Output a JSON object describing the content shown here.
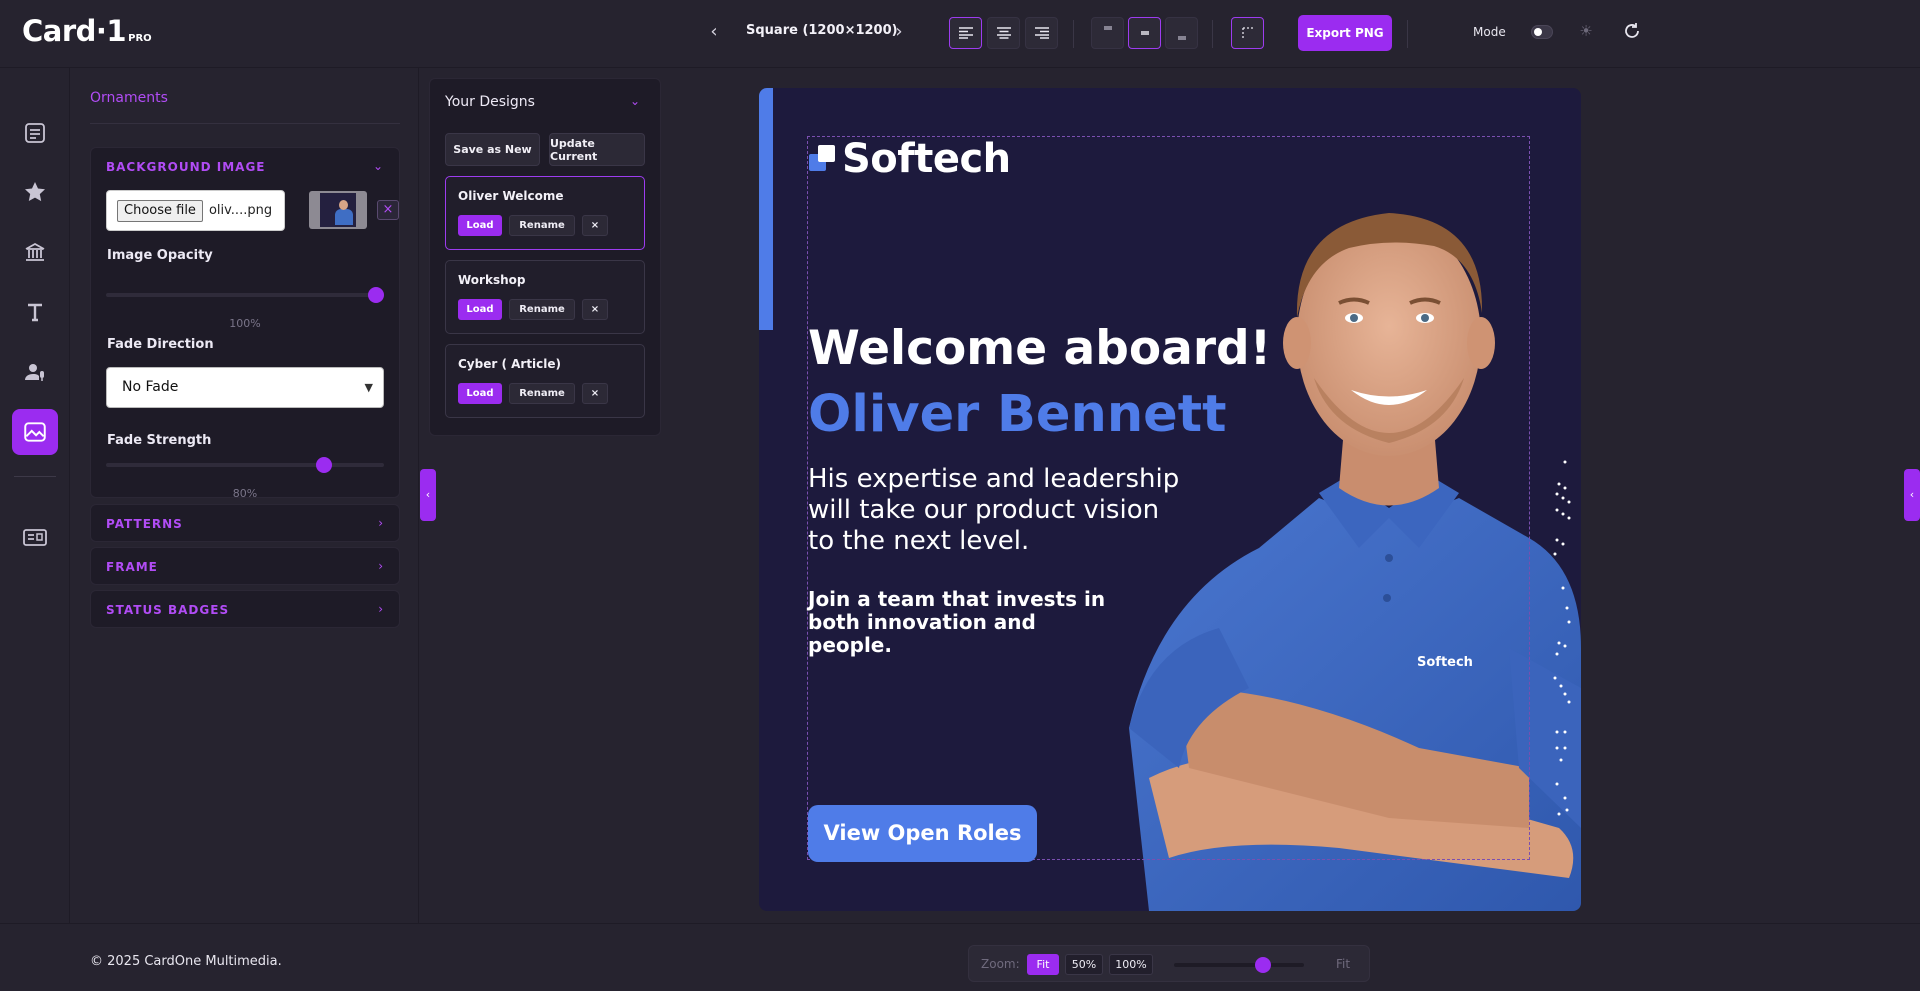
{
  "app": {
    "logo_main": "Card·1",
    "logo_sub": "PRO"
  },
  "toolbar": {
    "prev_label": "‹",
    "next_label": "›",
    "size_label": "Square (1200×1200)",
    "text_align_active": "left",
    "vertical_align_active": "middle",
    "export_label": "Export PNG",
    "mode_label": "Mode",
    "mode_dark": true
  },
  "rail": {
    "items": [
      "list-icon",
      "star-icon",
      "landmark-icon",
      "text-icon",
      "user-mic-icon",
      "image-icon",
      "id-card-icon"
    ],
    "active": "image-icon"
  },
  "settings": {
    "title": "Ornaments",
    "background_image": {
      "header": "BACKGROUND IMAGE",
      "choose_label": "Choose file",
      "file_name": "oliv....png",
      "remove_label": "×",
      "opacity_label": "Image Opacity",
      "opacity_value": "100%",
      "opacity_fraction": 1.0,
      "fade_direction_label": "Fade Direction",
      "fade_direction_value": "No Fade",
      "fade_strength_label": "Fade Strength",
      "fade_strength_value": "80%",
      "fade_strength_fraction": 0.8
    },
    "collapsed_sections": [
      "PATTERNS",
      "FRAME",
      "STATUS BADGES"
    ]
  },
  "designs": {
    "title": "Your Designs",
    "save_new_label": "Save as New",
    "update_label": "Update Current",
    "load_label": "Load",
    "rename_label": "Rename",
    "delete_label": "×",
    "items": [
      {
        "name": "Oliver Welcome",
        "active": true
      },
      {
        "name": "Workshop",
        "active": false
      },
      {
        "name": "Cyber ( Article)",
        "active": false
      }
    ]
  },
  "card": {
    "brand": "Softech",
    "headline": "Welcome aboard!",
    "name": "Oliver Bennett",
    "body": "His expertise and leadership will take our product vision to the next level.",
    "sub": "Join a team that invests in both innovation and people.",
    "cta": "View Open Roles",
    "shirt_logo": "Softech",
    "colors": {
      "background": "#1d1a3d",
      "accent": "#4f7ce8",
      "text": "#ffffff"
    }
  },
  "footer": {
    "copyright": "© 2025 CardOne Multimedia.",
    "zoom_label": "Zoom:",
    "zoom_fit": "Fit",
    "zoom_50": "50%",
    "zoom_100": "100%",
    "zoom_value": "Fit"
  },
  "theme": {
    "accent": "#9b2cf0",
    "panel_bg": "#26232f",
    "section_bg": "#1e1b27"
  }
}
